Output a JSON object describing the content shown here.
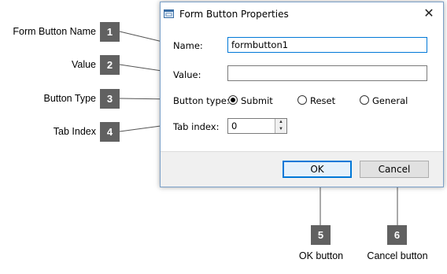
{
  "dialog": {
    "title": "Form Button Properties",
    "close_glyph": "✕",
    "name_label": "Name:",
    "name_value": "formbutton1",
    "value_label": "Value:",
    "value_value": "",
    "type_label": "Button type:",
    "type_options": [
      {
        "label": "Submit",
        "checked": true
      },
      {
        "label": "Reset",
        "checked": false
      },
      {
        "label": "General",
        "checked": false
      }
    ],
    "tab_label": "Tab index:",
    "tab_value": "0",
    "ok_label": "OK",
    "cancel_label": "Cancel"
  },
  "callouts": [
    {
      "num": "1",
      "label": "Form Button Name"
    },
    {
      "num": "2",
      "label": "Value"
    },
    {
      "num": "3",
      "label": "Button Type"
    },
    {
      "num": "4",
      "label": "Tab Index"
    },
    {
      "num": "5",
      "label": "OK button"
    },
    {
      "num": "6",
      "label": "Cancel button"
    }
  ],
  "icons": {
    "app": "window-icon",
    "close": "close-icon",
    "spin_up": "spin-up-icon",
    "spin_down": "spin-down-icon"
  },
  "colors": {
    "badge": "#616161",
    "focus_border": "#0078d7",
    "footer": "#f0f0f0"
  }
}
